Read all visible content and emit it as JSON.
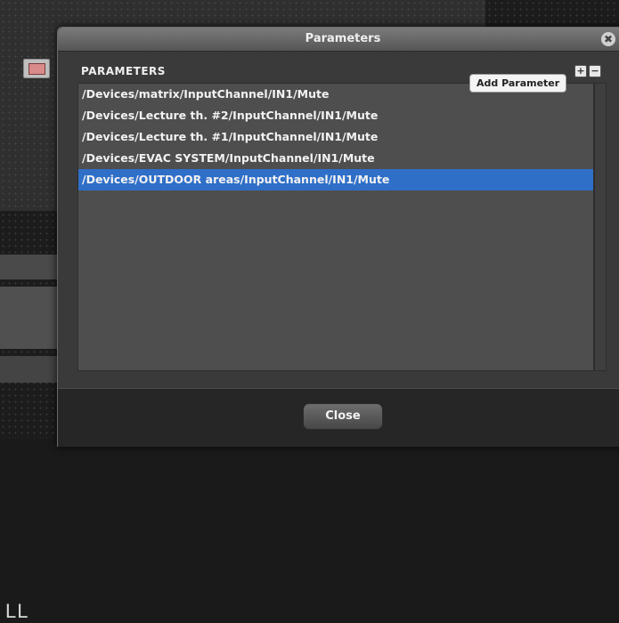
{
  "background": {
    "partial_label": "LL"
  },
  "dialog": {
    "title": "Parameters",
    "close_glyph": "✖",
    "section_label": "PARAMETERS",
    "add_glyph": "+",
    "remove_glyph": "−",
    "tooltip": "Add Parameter",
    "parameters": [
      "/Devices/matrix/InputChannel/IN1/Mute",
      "/Devices/Lecture th. #2/InputChannel/IN1/Mute",
      "/Devices/Lecture th. #1/InputChannel/IN1/Mute",
      "/Devices/EVAC SYSTEM/InputChannel/IN1/Mute",
      "/Devices/OUTDOOR areas/InputChannel/IN1/Mute"
    ],
    "selected_index": 4,
    "close_button": "Close"
  },
  "colors": {
    "selection": "#2f6fc8"
  }
}
